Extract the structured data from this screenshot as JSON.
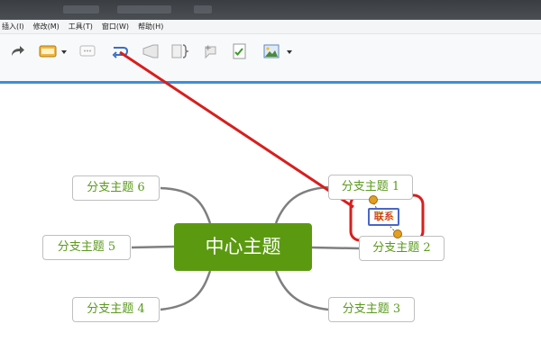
{
  "menubar": {
    "items": [
      "插入(I)",
      "修改(M)",
      "工具(T)",
      "窗口(W)",
      "帮助(H)"
    ]
  },
  "toolbar": {
    "icons": [
      "redo-icon",
      "topic-icon",
      "dropdown-arrow-icon",
      "callout-icon",
      "relationship-icon",
      "boundary-icon",
      "summary-icon",
      "marker-icon",
      "task-icon",
      "image-icon",
      "dropdown-arrow-icon"
    ]
  },
  "mindmap": {
    "central_topic": "中心主题",
    "branches": [
      {
        "label": "分支主题 1"
      },
      {
        "label": "分支主题 2"
      },
      {
        "label": "分支主题 3"
      },
      {
        "label": "分支主题 4"
      },
      {
        "label": "分支主题 5"
      },
      {
        "label": "分支主题 6"
      }
    ],
    "relationship_label": "联系"
  },
  "colors": {
    "central_fill": "#5b9a10",
    "branch_text": "#5a9a1c",
    "annotation_red": "#d81e1e",
    "toolbar_accent": "#3b8fd8"
  }
}
